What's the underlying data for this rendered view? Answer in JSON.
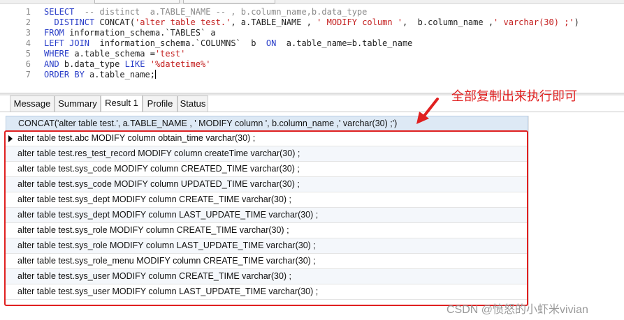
{
  "editor": {
    "lines": [
      {
        "n": "1",
        "segments": [
          {
            "t": "SELECT  ",
            "c": "kw"
          },
          {
            "t": "-- distinct  a.TABLE_NAME -- , b.column_name,b.data_type",
            "c": "cm"
          }
        ]
      },
      {
        "n": "2",
        "segments": [
          {
            "t": "  DISTINCT ",
            "c": "kw"
          },
          {
            "t": "CONCAT(",
            "c": ""
          },
          {
            "t": "'alter table test.'",
            "c": "str"
          },
          {
            "t": ", a.TABLE_NAME , ",
            "c": ""
          },
          {
            "t": "' MODIFY column '",
            "c": "str"
          },
          {
            "t": ",  b.column_name ,",
            "c": ""
          },
          {
            "t": "' varchar(30) ;'",
            "c": "str"
          },
          {
            "t": ")",
            "c": ""
          }
        ]
      },
      {
        "n": "3",
        "segments": [
          {
            "t": "FROM ",
            "c": "kw"
          },
          {
            "t": "information_schema.`TABLES` a",
            "c": ""
          }
        ]
      },
      {
        "n": "4",
        "segments": [
          {
            "t": "LEFT JOIN ",
            "c": "kw"
          },
          {
            "t": " information_schema.`COLUMNS`  b  ",
            "c": ""
          },
          {
            "t": "ON",
            "c": "kw"
          },
          {
            "t": "  a.table_name=b.table_name",
            "c": ""
          }
        ]
      },
      {
        "n": "5",
        "segments": [
          {
            "t": "WHERE ",
            "c": "kw"
          },
          {
            "t": "a.table_schema =",
            "c": ""
          },
          {
            "t": "'test'",
            "c": "str"
          }
        ]
      },
      {
        "n": "6",
        "segments": [
          {
            "t": "AND ",
            "c": "kw"
          },
          {
            "t": "b.data_type ",
            "c": ""
          },
          {
            "t": "LIKE ",
            "c": "kw"
          },
          {
            "t": "'%datetime%'",
            "c": "str"
          }
        ]
      },
      {
        "n": "7",
        "segments": [
          {
            "t": "ORDER BY ",
            "c": "kw"
          },
          {
            "t": "a.table_name;",
            "c": ""
          }
        ]
      }
    ]
  },
  "tabs": [
    {
      "label": "Message",
      "active": false
    },
    {
      "label": "Summary",
      "active": false
    },
    {
      "label": "Result 1",
      "active": true
    },
    {
      "label": "Profile",
      "active": false
    },
    {
      "label": "Status",
      "active": false
    }
  ],
  "result": {
    "column_header": "CONCAT('alter table test.', a.TABLE_NAME , ' MODIFY column ',  b.column_name ,' varchar(30) ;')",
    "rows": [
      "alter table test.abc MODIFY column obtain_time varchar(30) ;",
      "alter table test.res_test_record MODIFY column createTime varchar(30) ;",
      "alter table test.sys_code MODIFY column CREATED_TIME varchar(30) ;",
      "alter table test.sys_code MODIFY column UPDATED_TIME varchar(30) ;",
      "alter table test.sys_dept MODIFY column CREATE_TIME varchar(30) ;",
      "alter table test.sys_dept MODIFY column LAST_UPDATE_TIME varchar(30) ;",
      "alter table test.sys_role MODIFY column CREATE_TIME varchar(30) ;",
      "alter table test.sys_role MODIFY column LAST_UPDATE_TIME varchar(30) ;",
      "alter table test.sys_role_menu MODIFY column CREATE_TIME varchar(30) ;",
      "alter table test.sys_user MODIFY column CREATE_TIME varchar(30) ;",
      "alter table test.sys_user MODIFY column LAST_UPDATE_TIME varchar(30) ;"
    ]
  },
  "annotation": {
    "text": "全部复制出来执行即可",
    "color": "#e02020"
  },
  "watermark": "CSDN @愤怒的小虾米vivian"
}
